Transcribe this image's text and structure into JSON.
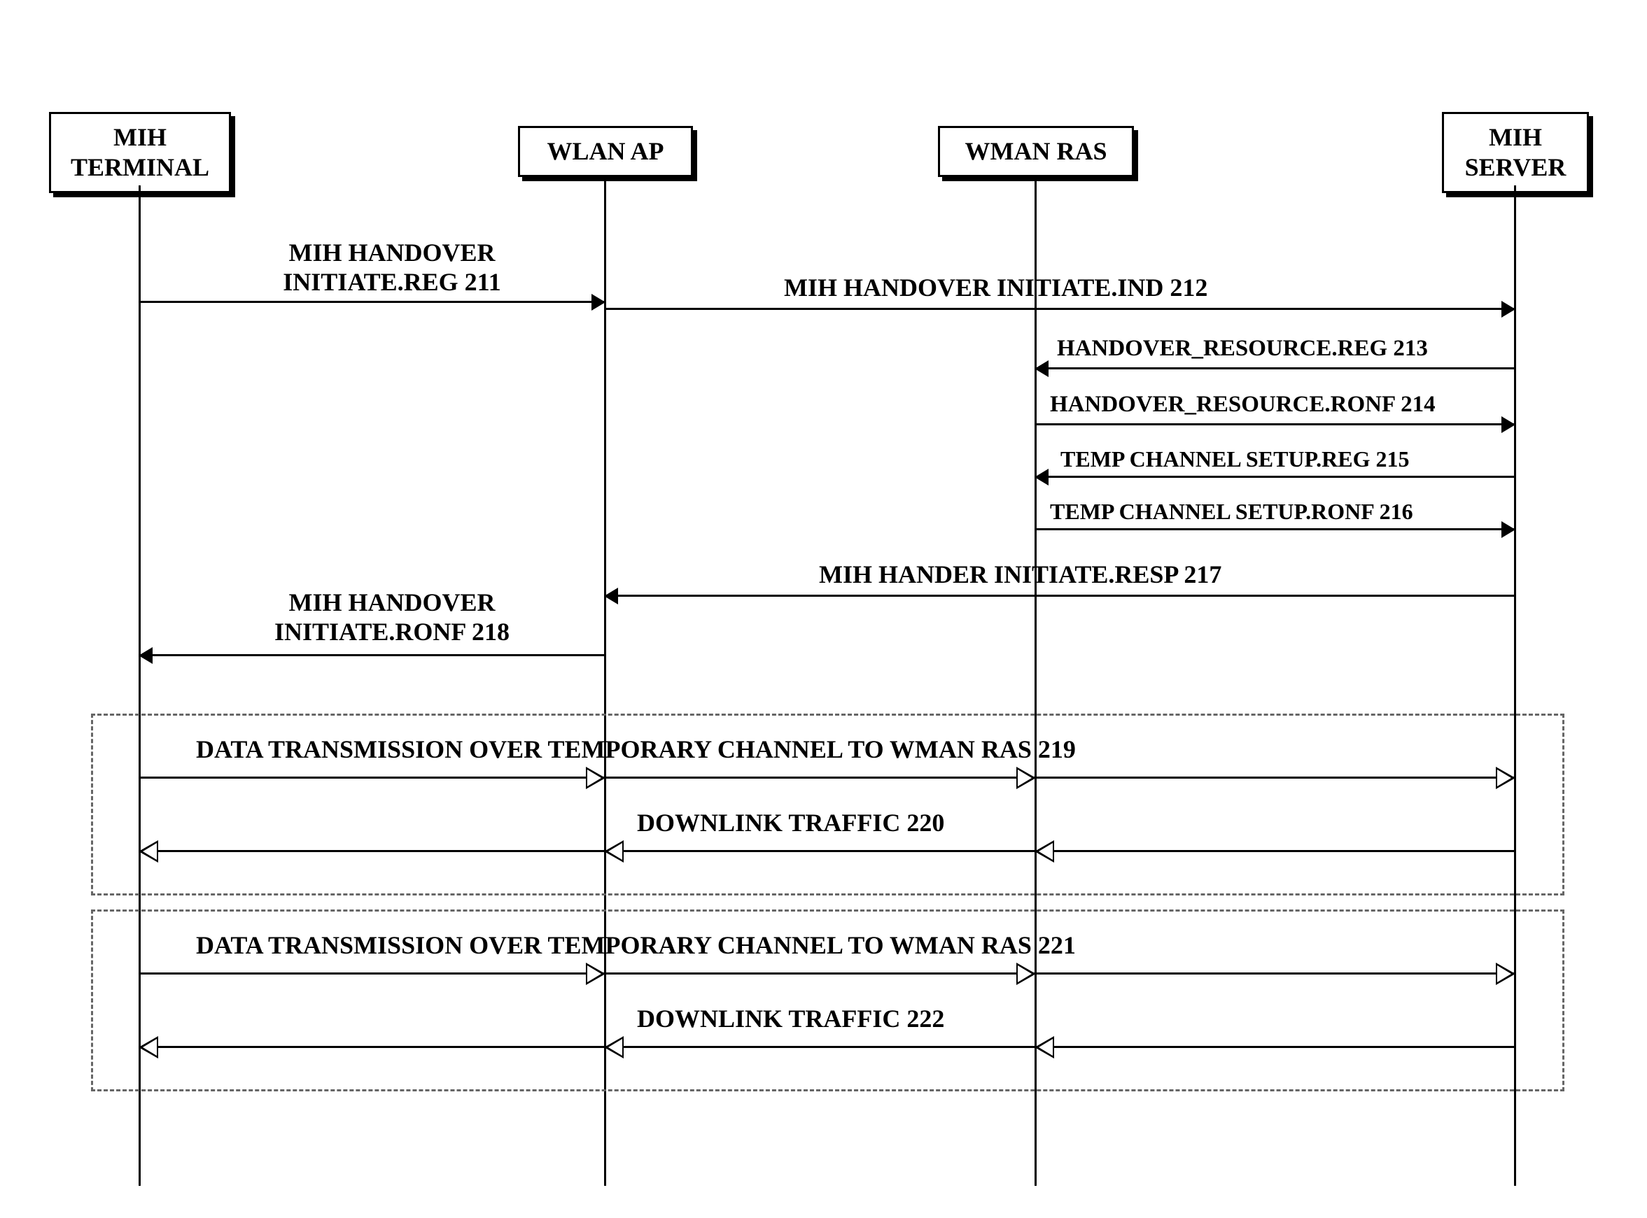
{
  "actors": {
    "terminal": "MIH\nTERMINAL",
    "wlan": "WLAN AP",
    "wman": "WMAN RAS",
    "server": "MIH\nSERVER"
  },
  "messages": {
    "m211": "MIH HANDOVER\nINITIATE.REG  211",
    "m212": "MIH HANDOVER INITIATE.IND  212",
    "m213": "HANDOVER_RESOURCE.REG  213",
    "m214": "HANDOVER_RESOURCE.RONF  214",
    "m215": "TEMP CHANNEL SETUP.REG  215",
    "m216": "TEMP CHANNEL SETUP.RONF  216",
    "m217": "MIH HANDER INITIATE.RESP  217",
    "m218": "MIH HANDOVER\nINITIATE.RONF  218",
    "m219": "DATA TRANSMISSION OVER TEMPORARY CHANNEL TO WMAN RAS  219",
    "m220": "DOWNLINK TRAFFIC  220",
    "m221": "DATA TRANSMISSION OVER TEMPORARY CHANNEL TO WMAN RAS  221",
    "m222": "DOWNLINK TRAFFIC  222"
  },
  "chart_data": {
    "type": "sequence-diagram",
    "actors": [
      "MIH TERMINAL",
      "WLAN AP",
      "WMAN RAS",
      "MIH SERVER"
    ],
    "messages": [
      {
        "id": 211,
        "from": "MIH TERMINAL",
        "to": "WLAN AP",
        "label": "MIH HANDOVER INITIATE.REG",
        "style": "solid"
      },
      {
        "id": 212,
        "from": "WLAN AP",
        "to": "MIH SERVER",
        "label": "MIH HANDOVER INITIATE.IND",
        "style": "solid"
      },
      {
        "id": 213,
        "from": "MIH SERVER",
        "to": "WMAN RAS",
        "label": "HANDOVER_RESOURCE.REG",
        "style": "solid"
      },
      {
        "id": 214,
        "from": "WMAN RAS",
        "to": "MIH SERVER",
        "label": "HANDOVER_RESOURCE.RONF",
        "style": "solid"
      },
      {
        "id": 215,
        "from": "MIH SERVER",
        "to": "WMAN RAS",
        "label": "TEMP CHANNEL SETUP.REG",
        "style": "solid"
      },
      {
        "id": 216,
        "from": "WMAN RAS",
        "to": "MIH SERVER",
        "label": "TEMP CHANNEL SETUP.RONF",
        "style": "solid"
      },
      {
        "id": 217,
        "from": "MIH SERVER",
        "to": "WLAN AP",
        "label": "MIH HANDER INITIATE.RESP",
        "style": "solid"
      },
      {
        "id": 218,
        "from": "WLAN AP",
        "to": "MIH TERMINAL",
        "label": "MIH HANDOVER INITIATE.RONF",
        "style": "solid"
      },
      {
        "id": 219,
        "from": "MIH TERMINAL",
        "to": "MIH SERVER",
        "label": "DATA TRANSMISSION OVER TEMPORARY CHANNEL TO WMAN RAS",
        "style": "open",
        "intermediate_heads": [
          "WLAN AP",
          "WMAN RAS"
        ]
      },
      {
        "id": 220,
        "from": "MIH SERVER",
        "to": "MIH TERMINAL",
        "label": "DOWNLINK TRAFFIC",
        "style": "open",
        "intermediate_heads": [
          "WMAN RAS",
          "WLAN AP"
        ]
      },
      {
        "id": 221,
        "from": "MIH TERMINAL",
        "to": "MIH SERVER",
        "label": "DATA TRANSMISSION OVER TEMPORARY CHANNEL TO WMAN RAS",
        "style": "open",
        "intermediate_heads": [
          "WLAN AP",
          "WMAN RAS"
        ]
      },
      {
        "id": 222,
        "from": "MIH SERVER",
        "to": "MIH TERMINAL",
        "label": "DOWNLINK TRAFFIC",
        "style": "open",
        "intermediate_heads": [
          "WMAN RAS",
          "WLAN AP"
        ]
      }
    ],
    "groups": [
      {
        "messages": [
          219,
          220
        ]
      },
      {
        "messages": [
          221,
          222
        ]
      }
    ]
  }
}
